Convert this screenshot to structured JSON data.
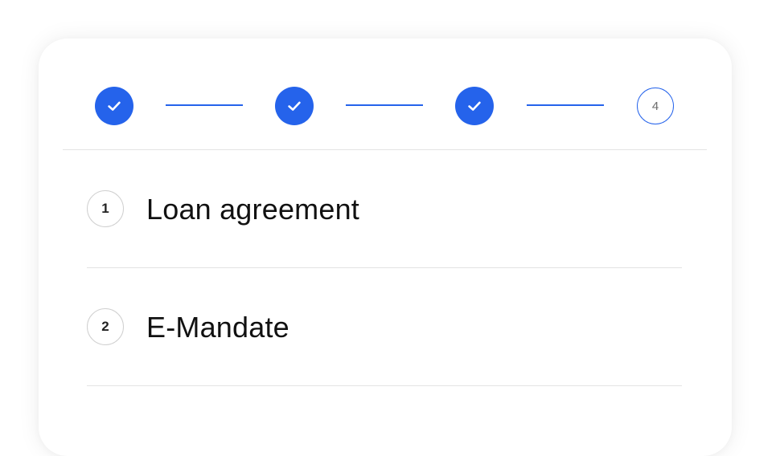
{
  "colors": {
    "accent": "#2563eb",
    "divider": "#e3e3e3",
    "number_border": "#cfcfcf"
  },
  "stepper": {
    "steps": [
      {
        "state": "completed",
        "icon": "checkmark-icon"
      },
      {
        "state": "completed",
        "icon": "checkmark-icon"
      },
      {
        "state": "completed",
        "icon": "checkmark-icon"
      },
      {
        "state": "current",
        "label": "4"
      }
    ]
  },
  "items": [
    {
      "number": "1",
      "label": "Loan agreement"
    },
    {
      "number": "2",
      "label": "E-Mandate"
    }
  ]
}
